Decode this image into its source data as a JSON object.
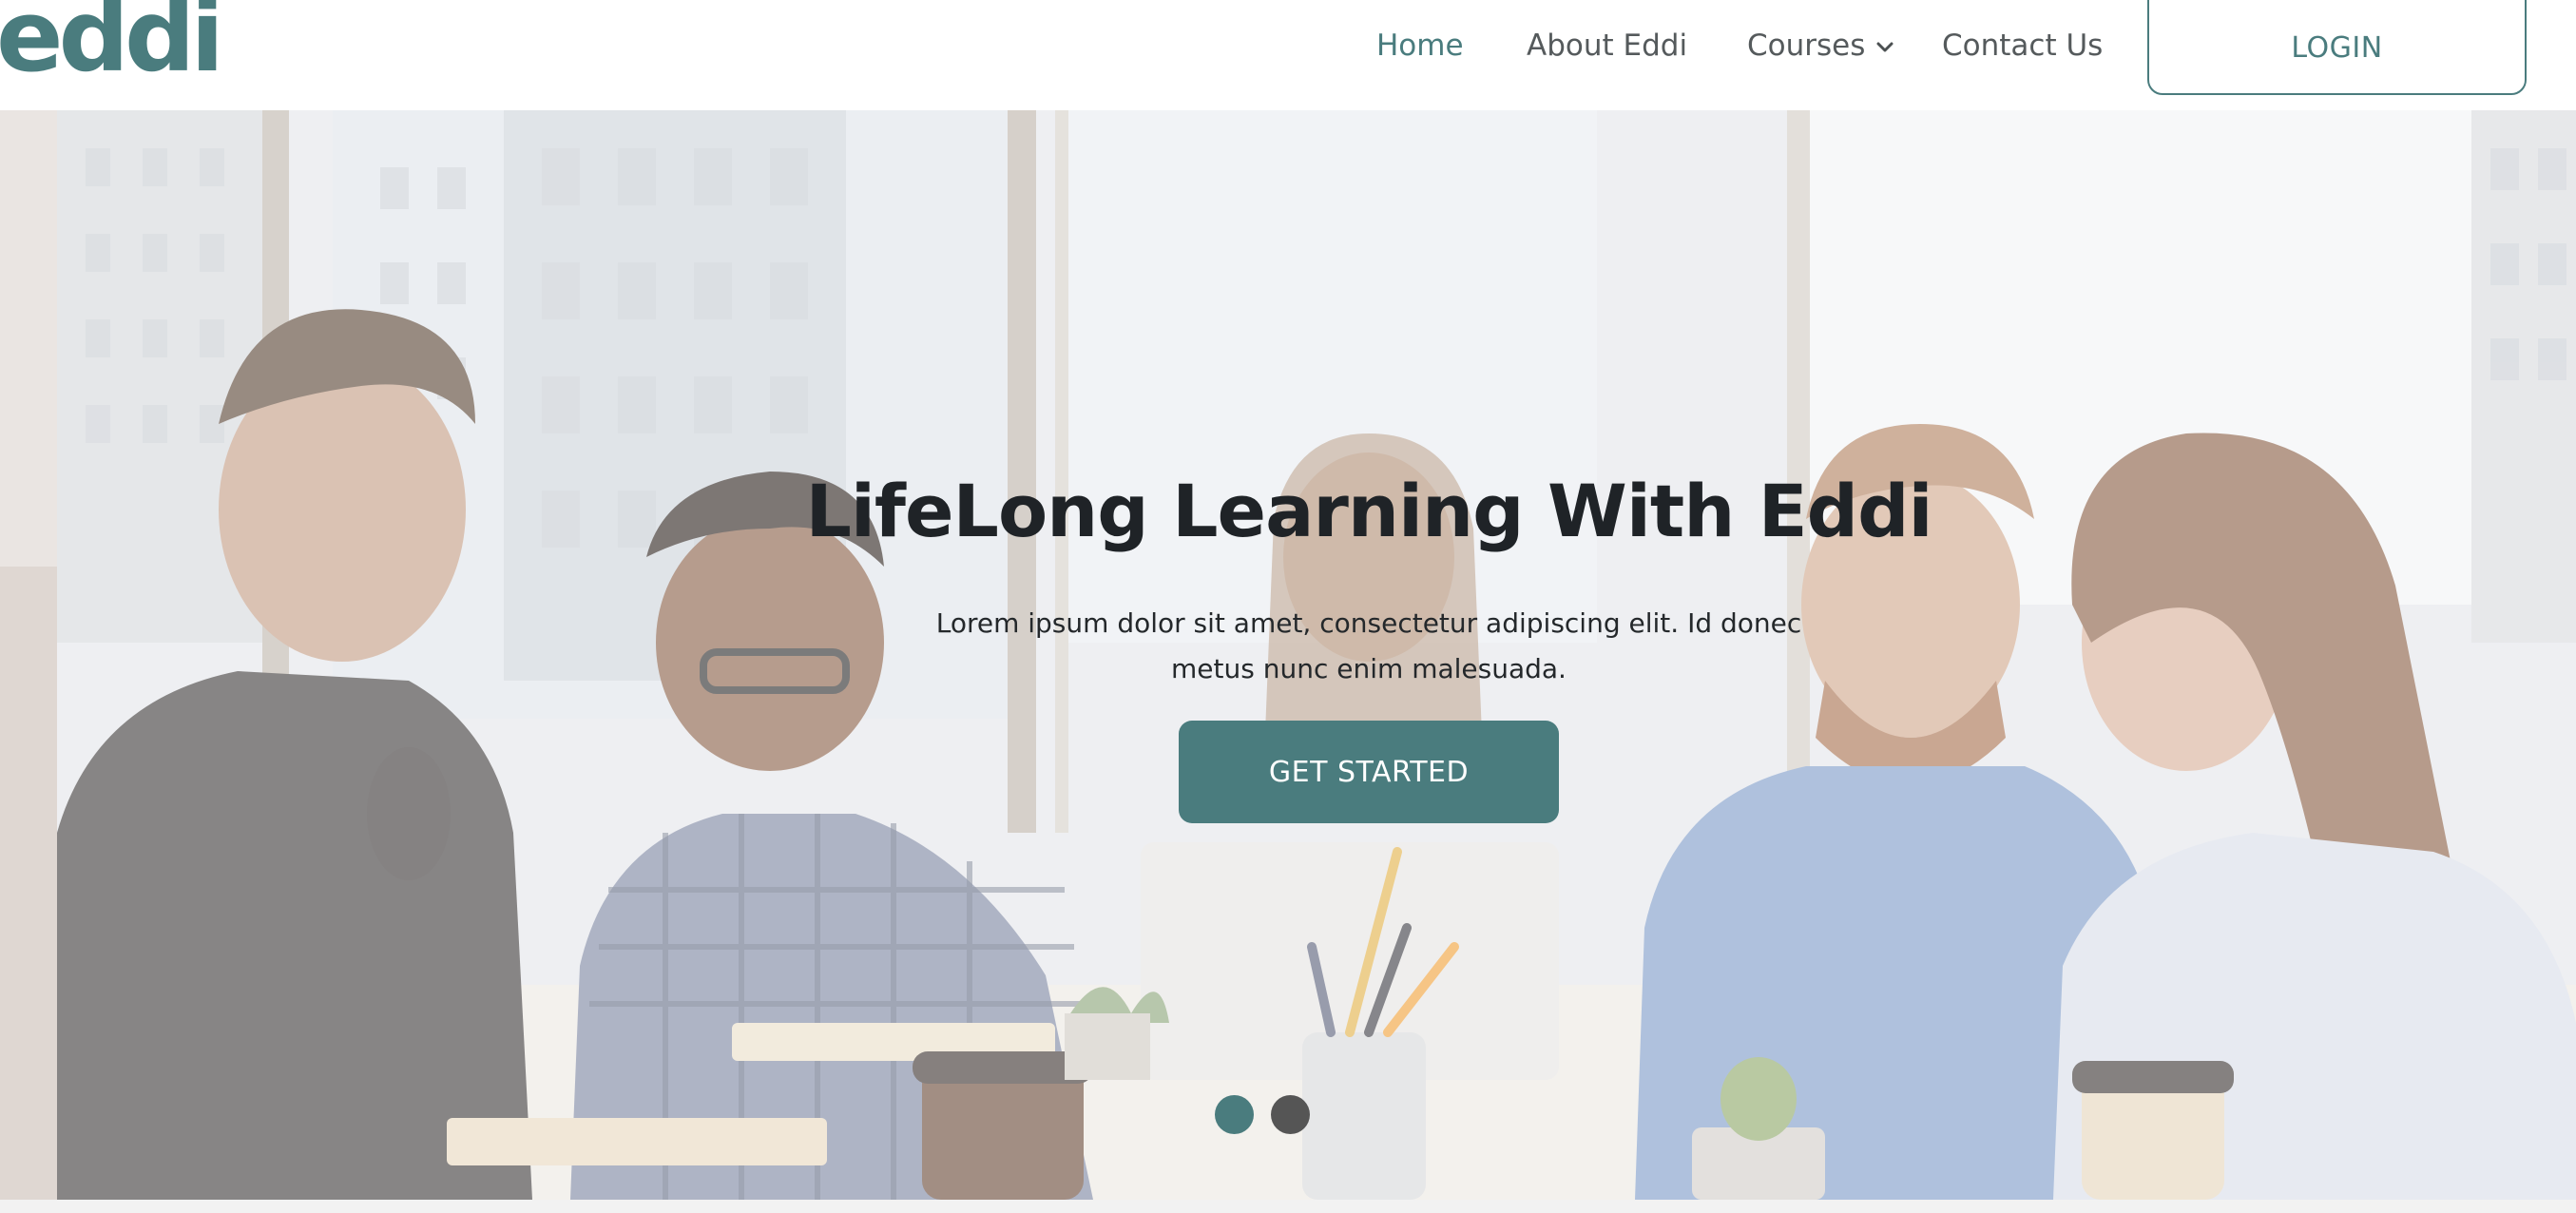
{
  "brand": {
    "logo_text": "eddi",
    "accent_color": "#4a7c7e",
    "text_color": "#1f2327"
  },
  "nav": {
    "items": [
      {
        "label": "Home",
        "active": true
      },
      {
        "label": "About Eddi",
        "active": false
      },
      {
        "label": "Courses",
        "active": false,
        "has_dropdown": true,
        "icon": "chevron-down-icon"
      },
      {
        "label": "Contact Us",
        "active": false
      }
    ],
    "login_label": "LOGIN"
  },
  "hero": {
    "title": "LifeLong Learning With Eddi",
    "subtitle_line1": "Lorem ipsum dolor sit amet, consectetur adipiscing elit. Id donec",
    "subtitle_line2": "metus nunc enim malesuada.",
    "cta_label": "GET STARTED",
    "carousel": {
      "slide_count": 2,
      "active_slide": 1,
      "active_color": "#4a7c7e",
      "inactive_color": "#555555"
    }
  }
}
